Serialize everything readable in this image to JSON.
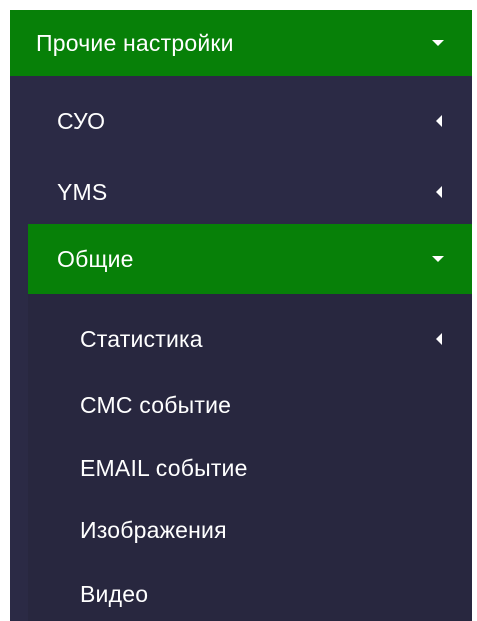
{
  "menu": {
    "items": [
      {
        "label": "Прочие настройки",
        "icon": "caret-down-icon",
        "active": true
      },
      {
        "label": "СУО",
        "icon": "caret-left-icon",
        "active": false
      },
      {
        "label": "YMS",
        "icon": "caret-left-icon",
        "active": false
      },
      {
        "label": "Общие",
        "icon": "caret-down-icon",
        "active": true
      },
      {
        "label": "Статистика",
        "icon": "caret-left-icon",
        "active": false
      },
      {
        "label": "СМС событие",
        "active": false
      },
      {
        "label": "EMAIL событие",
        "active": false
      },
      {
        "label": "Изображения",
        "active": false
      },
      {
        "label": "Видео",
        "active": false
      }
    ]
  },
  "colors": {
    "active_bg": "#078008",
    "menu_bg": "#2b2a45",
    "text": "#ffffff"
  }
}
